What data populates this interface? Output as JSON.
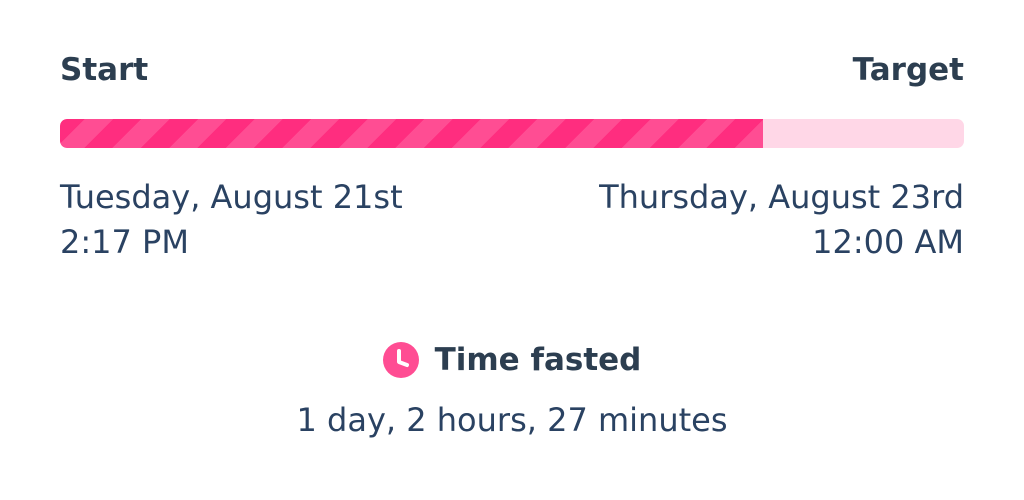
{
  "header": {
    "start_label": "Start",
    "target_label": "Target"
  },
  "progress": {
    "fraction": 0.778,
    "fill_color": "#ff2d7f",
    "stripe_color": "#ff4d93",
    "track_color": "#ffd7e7"
  },
  "start": {
    "date": "Tuesday, August 21st",
    "time": "2:17 PM"
  },
  "target": {
    "date": "Thursday, August 23rd",
    "time": "12:00 AM"
  },
  "time_fasted": {
    "icon": "clock-icon",
    "icon_color": "#ff4d93",
    "title": "Time fasted",
    "value": "1 day, 2 hours, 27 minutes"
  }
}
